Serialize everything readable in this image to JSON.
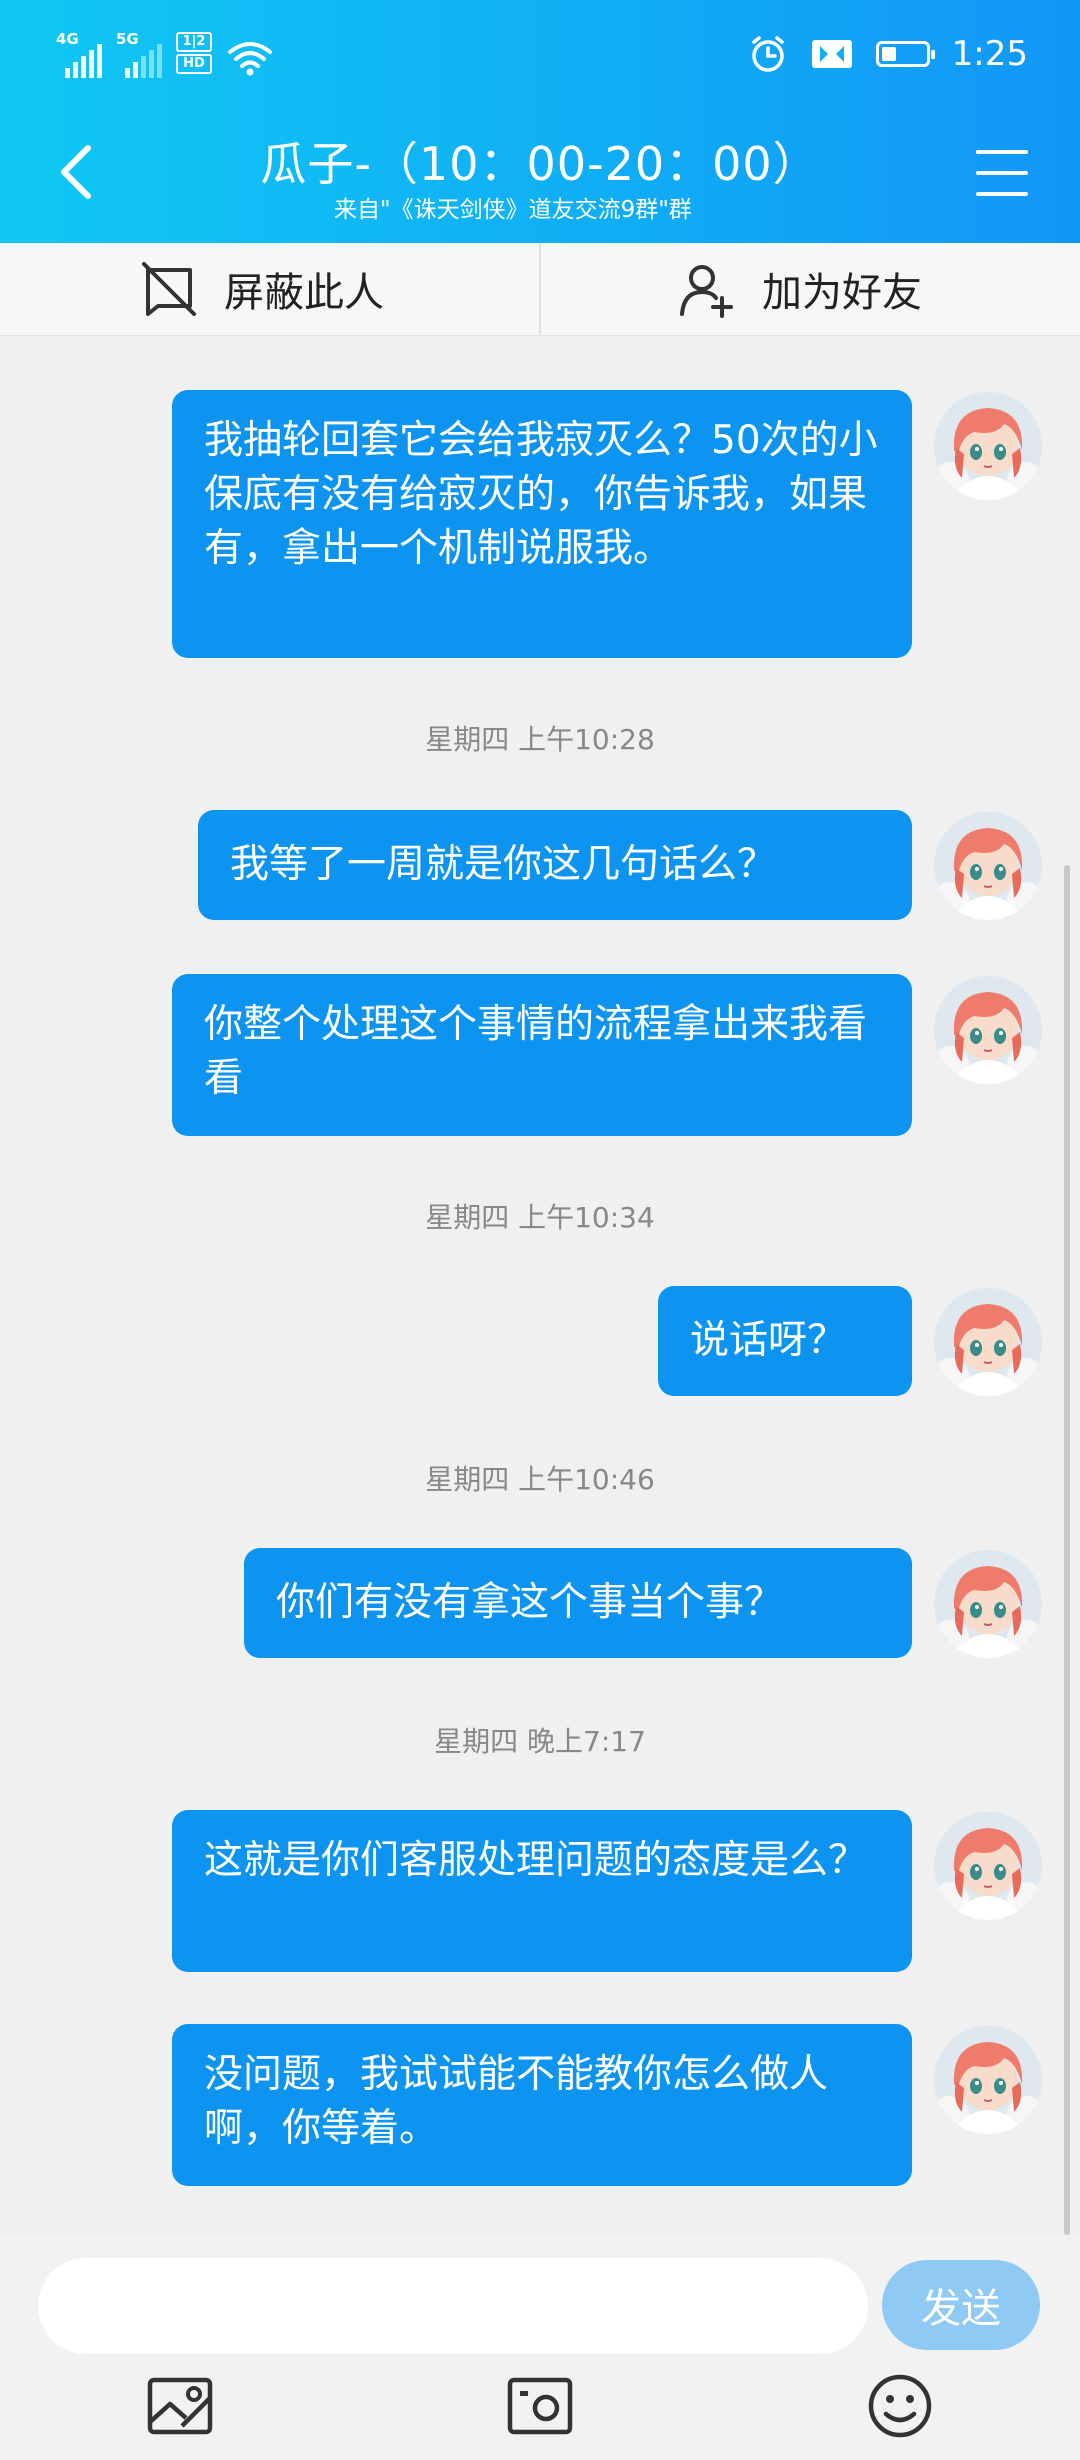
{
  "status_bar": {
    "signal1_label": "4G",
    "signal2_label": "5G",
    "hd_top": "1|2",
    "hd_bottom": "HD",
    "time": "1:25",
    "icons": [
      "signal-icon",
      "wifi-icon",
      "alarm-icon",
      "vibrate-icon",
      "battery-icon"
    ]
  },
  "header": {
    "title": "瓜子-（10：00-20：00）",
    "subtitle": "来自\"《诛天剑侠》道友交流9群\"群",
    "back_icon": "chevron-left-icon",
    "menu_icon": "menu-icon"
  },
  "actions": {
    "block_label": "屏蔽此人",
    "add_friend_label": "加为好友"
  },
  "messages": [
    {
      "text": "我抽轮回套它会给我寂灭么？50次的小保底有没有给寂灭的，你告诉我，如果有，拿出一个机制说服我。"
    },
    {
      "text": "我等了一周就是你这几句话么？"
    },
    {
      "text": "你整个处理这个事情的流程拿出来我看看"
    },
    {
      "text": "说话呀？"
    },
    {
      "text": "你们有没有拿这个事当个事？"
    },
    {
      "text": "这就是你们客服处理问题的态度是么？"
    },
    {
      "text": "没问题，我试试能不能教你怎么做人啊，你等着。"
    }
  ],
  "timestamps": [
    "星期四 上午10:28",
    "星期四 上午10:34",
    "星期四 上午10:46",
    "星期四 晚上7:17"
  ],
  "input": {
    "value": "",
    "send_label": "发送"
  },
  "colors": {
    "header_start": "#10c8f3",
    "header_end": "#1296f7",
    "bubble": "#0d94f0",
    "send_button": "#8fcaf5"
  }
}
